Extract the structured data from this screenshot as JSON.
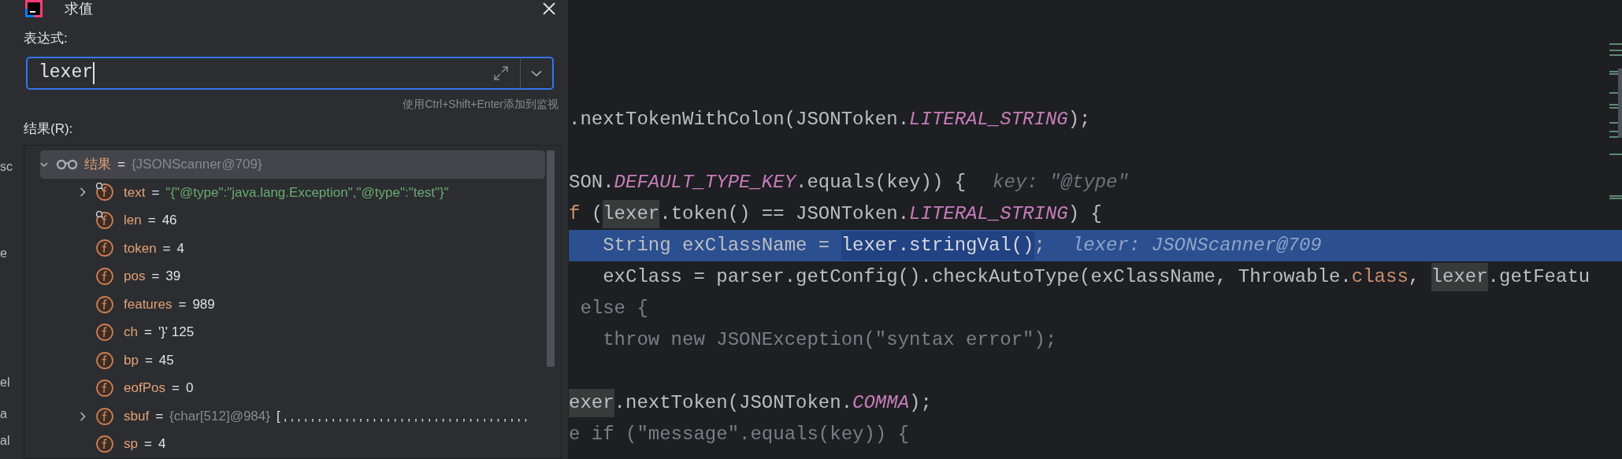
{
  "background_fragments": [
    "sc",
    "e",
    "el",
    "a",
    "al"
  ],
  "dialog": {
    "title": "求值",
    "expression_label": "表达式:",
    "expression": {
      "value": "lexer",
      "focused": true
    },
    "hint": "使用Ctrl+Shift+Enter添加到监视",
    "result_label": "结果(R):",
    "tree": [
      {
        "kind": "root",
        "name": "结果",
        "separator": "=",
        "ref_value": "{JSONScanner@709}",
        "expanded": true,
        "selected": true
      },
      {
        "kind": "watched",
        "name": "text",
        "separator": "=",
        "string_value": "\"{\"@type\":\"java.lang.Exception\",\"@type\":\"test\"}\"",
        "expanded": false,
        "selected": false
      },
      {
        "kind": "watched",
        "name": "len",
        "separator": "=",
        "value": "46",
        "selected": false
      },
      {
        "kind": "field",
        "name": "token",
        "separator": "=",
        "value": "4",
        "selected": false
      },
      {
        "kind": "field",
        "name": "pos",
        "separator": "=",
        "value": "39",
        "selected": false
      },
      {
        "kind": "field",
        "name": "features",
        "separator": "=",
        "value": "989",
        "selected": false
      },
      {
        "kind": "field",
        "name": "ch",
        "separator": "=",
        "value": "'}' 125",
        "selected": false
      },
      {
        "kind": "field",
        "name": "bp",
        "separator": "=",
        "value": "45",
        "selected": false
      },
      {
        "kind": "field",
        "name": "eofPos",
        "separator": "=",
        "value": "0",
        "selected": false
      },
      {
        "kind": "field",
        "name": "sbuf",
        "separator": "=",
        "ref_value": "{char[512]@984}",
        "extra": "[,,,,,,,,,,,,,,,,,,,,,,,,,,,,,,,,,,,,",
        "expanded": false,
        "selected": false
      },
      {
        "kind": "field",
        "name": "sp",
        "separator": "=",
        "value": "4",
        "selected": false
      }
    ]
  },
  "editor": {
    "lines": [
      {
        "current": false
      },
      {
        "current": false
      },
      {
        "current": false
      },
      {
        "current": false,
        "tokens": [
          {
            "text": ".nextTokenWithColon(JSONToken.",
            "kind": "plain"
          },
          {
            "text": "LITERAL_STRING",
            "kind": "const"
          },
          {
            "text": ");",
            "kind": "plain"
          }
        ]
      },
      {
        "current": false
      },
      {
        "current": false,
        "tokens": [
          {
            "text": "SON.",
            "kind": "plain"
          },
          {
            "text": "DEFAULT_TYPE_KEY",
            "kind": "const"
          },
          {
            "text": ".equals(key)) {",
            "kind": "plain"
          },
          {
            "text": "key: \"@type\"",
            "kind": "hint"
          }
        ]
      },
      {
        "current": false,
        "tokens": [
          {
            "text": "f",
            "kind": "keyword"
          },
          {
            "text": " (",
            "kind": "plain"
          },
          {
            "text": "lexer",
            "kind": "ref"
          },
          {
            "text": ".token() == JSONToken.",
            "kind": "plain"
          },
          {
            "text": "LITERAL_STRING",
            "kind": "const"
          },
          {
            "text": ") {",
            "kind": "plain"
          }
        ]
      },
      {
        "current": true,
        "tokens": [
          {
            "text": "   String exClassName = ",
            "kind": "plain"
          },
          {
            "text": "lexer.stringVal()",
            "kind": "selection"
          },
          {
            "text": ";",
            "kind": "plain"
          },
          {
            "text": "lexer: JSONScanner@709",
            "kind": "hint"
          }
        ]
      },
      {
        "current": false,
        "tokens": [
          {
            "text": "   exClass = parser.getConfig().checkAutoType(exClassName, Throwable.",
            "kind": "plain"
          },
          {
            "text": "class",
            "kind": "keyword"
          },
          {
            "text": ", ",
            "kind": "plain"
          },
          {
            "text": "lexer",
            "kind": "ref"
          },
          {
            "text": ".getFeatu",
            "kind": "plain"
          }
        ]
      },
      {
        "current": false,
        "tokens": [
          {
            "text": " else {",
            "kind": "dim"
          }
        ]
      },
      {
        "current": false,
        "tokens": [
          {
            "text": "   throw new JSONException(\"syntax error\");",
            "kind": "dim"
          }
        ]
      },
      {
        "current": false
      },
      {
        "current": false,
        "tokens": [
          {
            "text": "exer",
            "kind": "ref"
          },
          {
            "text": ".nextToken(JSONToken.",
            "kind": "plain"
          },
          {
            "text": "COMMA",
            "kind": "const"
          },
          {
            "text": ");",
            "kind": "plain"
          }
        ]
      },
      {
        "current": false,
        "tokens": [
          {
            "text": "e if (\"message\".equals(key)) {",
            "kind": "dim"
          }
        ]
      }
    ]
  }
}
